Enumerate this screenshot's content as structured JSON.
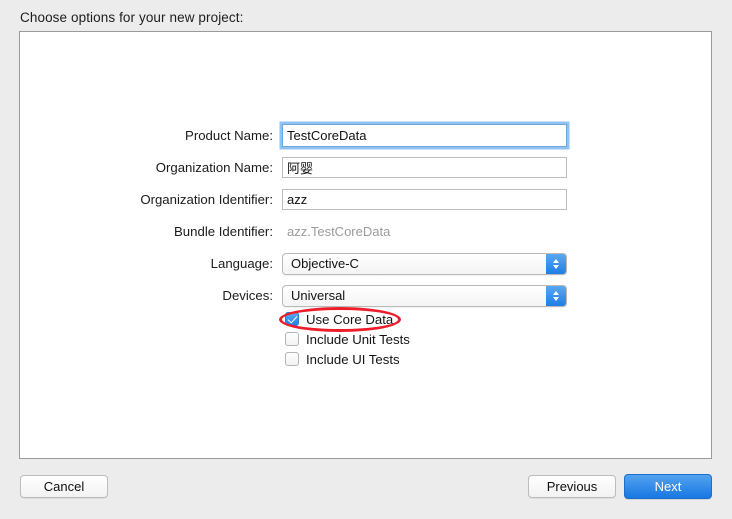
{
  "dialog": {
    "prompt": "Choose options for your new project:"
  },
  "form": {
    "fields": [
      {
        "label": "Product Name:",
        "value": "TestCoreData",
        "type": "text",
        "focused": true
      },
      {
        "label": "Organization Name:",
        "value": "阿婴",
        "type": "text",
        "focused": false
      },
      {
        "label": "Organization Identifier:",
        "value": "azz",
        "type": "text",
        "focused": false
      },
      {
        "label": "Bundle Identifier:",
        "value": "azz.TestCoreData",
        "type": "static",
        "focused": false
      },
      {
        "label": "Language:",
        "value": "Objective-C",
        "type": "popup",
        "focused": false
      },
      {
        "label": "Devices:",
        "value": "Universal",
        "type": "popup",
        "focused": false
      }
    ],
    "checkboxes": [
      {
        "label": "Use Core Data",
        "checked": true
      },
      {
        "label": "Include Unit Tests",
        "checked": false
      },
      {
        "label": "Include UI Tests",
        "checked": false
      }
    ]
  },
  "annotation": {
    "color": "#ee1d2a",
    "target": "Use Core Data"
  },
  "buttons": {
    "cancel": "Cancel",
    "previous": "Previous",
    "next": "Next"
  },
  "colors": {
    "window_background": "#ececec",
    "panel_background": "#ffffff",
    "accent_blue": "#1877e2",
    "focus_ring": "#6aa9e0",
    "annotation_red": "#ee1d2a",
    "muted_text": "#9b9b9b"
  }
}
